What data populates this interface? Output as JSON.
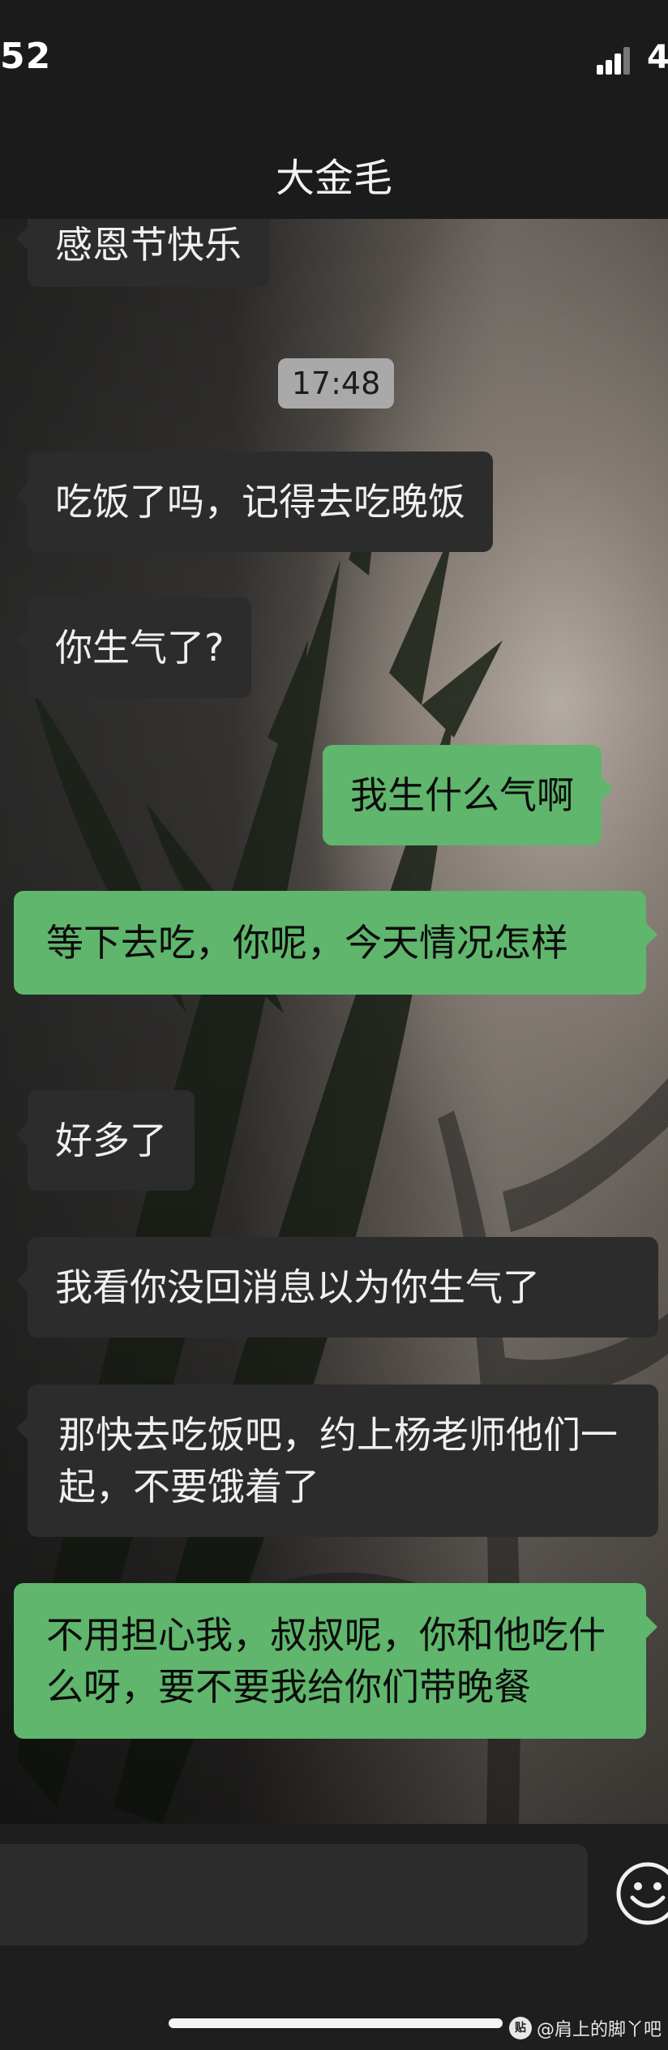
{
  "status": {
    "time": "52",
    "battery": "4"
  },
  "nav": {
    "title": "大金毛"
  },
  "timestamp": "17:48",
  "messages": [
    {
      "from": "contact",
      "text": "感恩节快乐"
    },
    {
      "from": "contact",
      "text": "吃饭了吗，记得去吃晚饭"
    },
    {
      "from": "contact",
      "text": "你生气了?"
    },
    {
      "from": "me",
      "text": "我生什么气啊"
    },
    {
      "from": "me",
      "text": "等下去吃，你呢，今天情况怎样"
    },
    {
      "from": "contact",
      "text": "好多了"
    },
    {
      "from": "contact",
      "text": "我看你没回消息以为你生气了"
    },
    {
      "from": "contact",
      "text": "那快去吃饭吧，约上杨老师他们一起，不要饿着了"
    },
    {
      "from": "me",
      "text": "不用担心我，叔叔呢，你和他吃什么呀，要不要我给你们带晚餐"
    }
  ],
  "input_bar": {
    "emoji_icon": "smiley-face-icon"
  },
  "watermark": {
    "logo": "贴",
    "text": "@肩上的脚丫吧"
  },
  "colors": {
    "incoming_bubble": "#2c2c2c",
    "outgoing_bubble": "#5fb66c",
    "bar_background": "#1b1b1b"
  }
}
